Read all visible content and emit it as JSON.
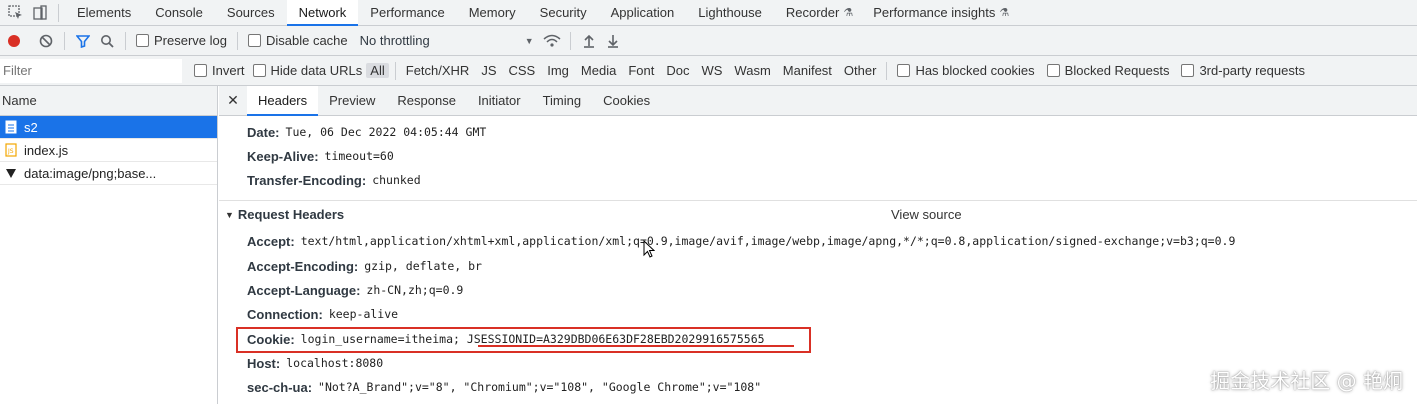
{
  "panel_tabs": [
    "Elements",
    "Console",
    "Sources",
    "Network",
    "Performance",
    "Memory",
    "Security",
    "Application",
    "Lighthouse",
    "Recorder",
    "Performance insights"
  ],
  "toolbar": {
    "preserve_log": "Preserve log",
    "disable_cache": "Disable cache",
    "throttling": "No throttling"
  },
  "filterbar": {
    "placeholder": "Filter",
    "invert": "Invert",
    "hide_data_urls": "Hide data URLs",
    "types": [
      "All",
      "Fetch/XHR",
      "JS",
      "CSS",
      "Img",
      "Media",
      "Font",
      "Doc",
      "WS",
      "Wasm",
      "Manifest",
      "Other"
    ],
    "blocked_cookies": "Has blocked cookies",
    "blocked_requests": "Blocked Requests",
    "third_party": "3rd-party requests"
  },
  "requests": {
    "column": "Name",
    "items": [
      "s2",
      "index.js",
      "data:image/png;base..."
    ]
  },
  "detail_tabs": [
    "Headers",
    "Preview",
    "Response",
    "Initiator",
    "Timing",
    "Cookies"
  ],
  "response_headers": [
    {
      "key": "Date:",
      "value": "Tue, 06 Dec 2022 04:05:44 GMT"
    },
    {
      "key": "Keep-Alive:",
      "value": "timeout=60"
    },
    {
      "key": "Transfer-Encoding:",
      "value": "chunked"
    }
  ],
  "request_section": {
    "title": "Request Headers",
    "view_source": "View source"
  },
  "request_headers": [
    {
      "key": "Accept:",
      "value": "text/html,application/xhtml+xml,application/xml;q=0.9,image/avif,image/webp,image/apng,*/*;q=0.8,application/signed-exchange;v=b3;q=0.9"
    },
    {
      "key": "Accept-Encoding:",
      "value": "gzip, deflate, br"
    },
    {
      "key": "Accept-Language:",
      "value": "zh-CN,zh;q=0.9"
    },
    {
      "key": "Connection:",
      "value": "keep-alive"
    },
    {
      "key": "Cookie:",
      "value": "login_username=itheima; JSESSIONID=A329DBD06E63DF28EBD2029916575565"
    },
    {
      "key": "Host:",
      "value": "localhost:8080"
    },
    {
      "key": "sec-ch-ua:",
      "value": "\"Not?A_Brand\";v=\"8\", \"Chromium\";v=\"108\", \"Google Chrome\";v=\"108\""
    }
  ],
  "watermark": "掘金技术社区 @ 艳炯",
  "colors": {
    "accent": "#1a73e8",
    "record": "#d93025",
    "highlight_box": "#d93025"
  }
}
